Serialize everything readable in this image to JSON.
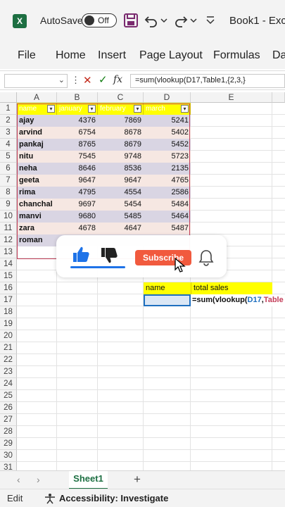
{
  "titlebar": {
    "logo_letter": "X",
    "autosave_label": "AutoSave",
    "autosave_state": "Off",
    "doc_title": "Book1 - Exc"
  },
  "ribbon": {
    "tabs": [
      "File",
      "Home",
      "Insert",
      "Page Layout",
      "Formulas",
      "Da"
    ]
  },
  "formula_bar": {
    "name_box_value": "",
    "formula": "=sum(vlookup(D17,Table1,{2,3,}"
  },
  "grid": {
    "columns": [
      "A",
      "B",
      "C",
      "D",
      "E"
    ],
    "row_numbers": [
      "1",
      "2",
      "3",
      "4",
      "5",
      "6",
      "7",
      "8",
      "9",
      "10",
      "11",
      "12",
      "13",
      "14",
      "15",
      "16",
      "17",
      "18",
      "19",
      "20",
      "21",
      "22",
      "23",
      "24",
      "25",
      "26",
      "27",
      "28",
      "29",
      "30",
      "31"
    ],
    "table_headers": [
      "name",
      "january",
      "february",
      "march"
    ],
    "table_rows": [
      [
        "ajay",
        "4376",
        "7869",
        "5241"
      ],
      [
        "arvind",
        "6754",
        "8678",
        "5402"
      ],
      [
        "pankaj",
        "8765",
        "8679",
        "5452"
      ],
      [
        "nitu",
        "7545",
        "9748",
        "5723"
      ],
      [
        "neha",
        "8646",
        "8536",
        "2135"
      ],
      [
        "geeta",
        "9647",
        "9647",
        "4765"
      ],
      [
        "rima",
        "4795",
        "4554",
        "2586"
      ],
      [
        "chanchal",
        "9697",
        "5454",
        "5484"
      ],
      [
        "manvi",
        "9680",
        "5485",
        "5464"
      ],
      [
        "zara",
        "4678",
        "4647",
        "5487"
      ],
      [
        "roman",
        "",
        "",
        ""
      ]
    ],
    "lookup_headers": [
      "name",
      "total sales"
    ],
    "editing_formula": "=sum(vlookup(D17,Table",
    "colors": {
      "header_fill": "#ffff00",
      "band_a": "#d9d5e3",
      "band_b": "#f6e7e2",
      "table_border": "#c43f5a"
    }
  },
  "overlay": {
    "subscribe_label": "Subscribe",
    "accent_color": "#f15a3e",
    "like_icon": "thumbs-up-icon",
    "dislike_icon": "thumbs-down-icon",
    "bell_icon": "bell-icon"
  },
  "sheets": {
    "tabs": [
      "Sheet1"
    ],
    "add_label": "+"
  },
  "status": {
    "mode": "Edit",
    "accessibility": "Accessibility: Investigate"
  }
}
